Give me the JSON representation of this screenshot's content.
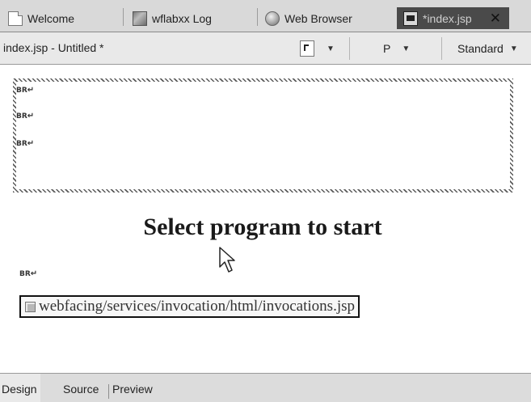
{
  "editor_tabs": [
    {
      "label": "Welcome",
      "icon": "page-icon"
    },
    {
      "label": "wflabxx Log",
      "icon": "log-icon"
    },
    {
      "label": "Web Browser",
      "icon": "globe-icon"
    },
    {
      "label": "*index.jsp",
      "icon": "jsp-file-icon",
      "active": true,
      "close_symbol": "✕"
    }
  ],
  "toolbar": {
    "file_label": "index.jsp - Untitled *",
    "paragraph_format_icon": "paragraph-format-icon",
    "paragraph_style": "P",
    "font_style": "Standard",
    "dropdown_symbol": "▼"
  },
  "canvas": {
    "br_marker": "BR",
    "return_symbol": "↵",
    "heading": "Select program to start",
    "include_path": "webfacing/services/invocation/html/invocations.jsp"
  },
  "bottom_tabs": [
    "Design",
    "Source",
    "Preview"
  ],
  "colors": {
    "tab_bar_bg": "#d9d9d9",
    "active_tab_bg": "#4a4a4a",
    "toolbar_bg": "#e9e9e9",
    "canvas_bg": "#ffffff"
  }
}
